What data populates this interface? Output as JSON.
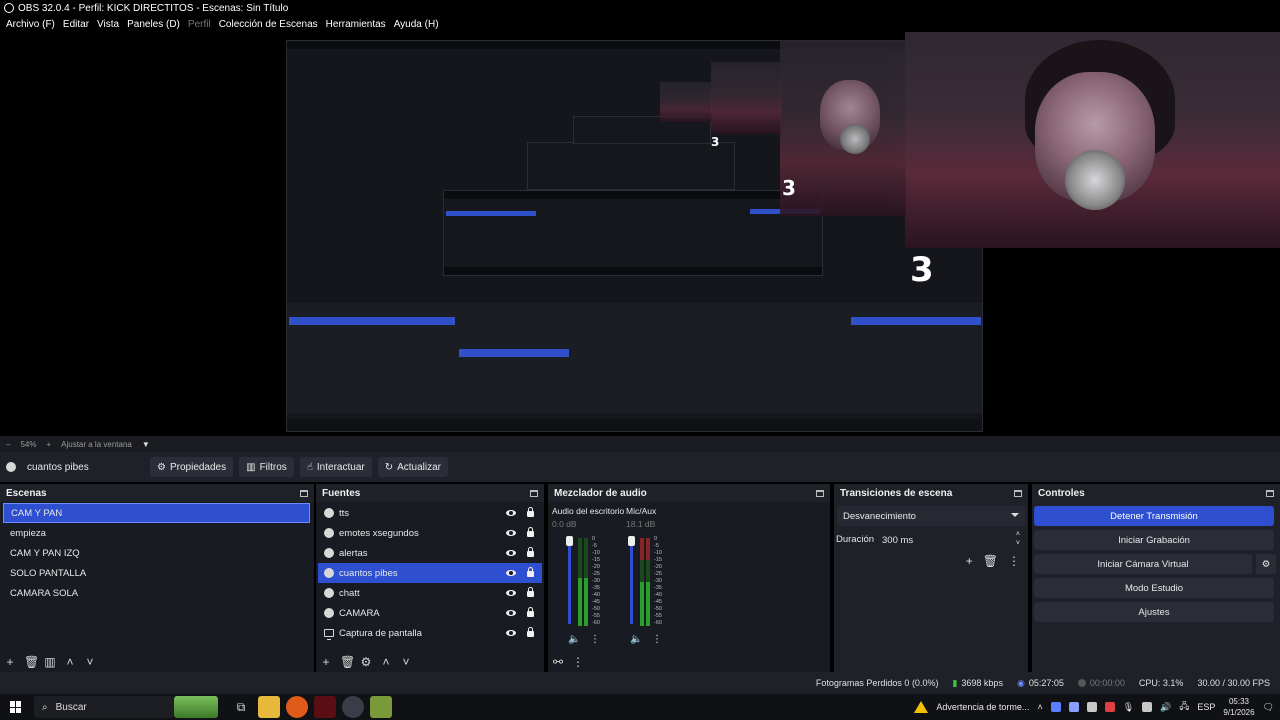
{
  "window": {
    "title": "OBS 32.0.4 - Perfil: KICK DIRECTITOS - Escenas: Sin Título"
  },
  "menu": [
    "Archivo (F)",
    "Editar",
    "Vista",
    "Paneles (D)",
    "Perfil",
    "Colección de Escenas",
    "Herramientas",
    "Ayuda (H)"
  ],
  "preview": {
    "countdown_1": "3",
    "countdown_2": "3",
    "countdown_3": "3",
    "zoom_label": "54%",
    "fit_label": "Ajustar a la ventana"
  },
  "source_toolbar": {
    "selected_source": "cuantos pibes",
    "properties": "Propiedades",
    "filters": "Filtros",
    "interact": "Interactuar",
    "refresh": "Actualizar"
  },
  "scenes": {
    "title": "Escenas",
    "items": [
      "CAM Y PAN",
      "empieza",
      "CAM Y PAN IZQ",
      "SOLO PANTALLA",
      "CAMARA SOLA"
    ],
    "selected_index": 0
  },
  "sources": {
    "title": "Fuentes",
    "items": [
      {
        "name": "tts",
        "icon": "browser-icon"
      },
      {
        "name": "emotes xsegundos",
        "icon": "browser-icon"
      },
      {
        "name": "alertas",
        "icon": "browser-icon"
      },
      {
        "name": "cuantos pibes",
        "icon": "browser-icon"
      },
      {
        "name": "chatt",
        "icon": "browser-icon"
      },
      {
        "name": "CAMARA",
        "icon": "browser-icon"
      },
      {
        "name": "Captura de pantalla",
        "icon": "monitor-icon"
      }
    ],
    "selected_index": 3
  },
  "mixer": {
    "title": "Mezclador de audio",
    "channels": [
      {
        "name": "Audio del escritorio",
        "db": "0.0 dB",
        "level": 0.55
      },
      {
        "name": "Mic/Aux",
        "db": "18.1 dB",
        "level": 0.5
      }
    ],
    "scale": [
      "0",
      "-5",
      "-10",
      "-15",
      "-20",
      "-25",
      "-30",
      "-35",
      "-40",
      "-45",
      "-50",
      "-55",
      "-60"
    ]
  },
  "transitions": {
    "title": "Transiciones de escena",
    "selected": "Desvanecimiento",
    "duration_label": "Duración",
    "duration_value": "300 ms"
  },
  "controls": {
    "title": "Controles",
    "stop_stream": "Detener Transmisión",
    "start_recording": "Iniciar Grabación",
    "start_virtual_cam": "Iniciar Cámara Virtual",
    "studio_mode": "Modo Estudio",
    "settings": "Ajustes"
  },
  "status": {
    "dropped": "Fotogramas Perdidos 0 (0.0%)",
    "bitrate": "3698 kbps",
    "stream_time": "05:27:05",
    "rec_time": "00:00:00",
    "cpu": "CPU: 3.1%",
    "fps": "30.00 / 30.00 FPS"
  },
  "taskbar": {
    "search": "Buscar",
    "warning": "Advertencia de torme...",
    "lang": "ESP",
    "time": "05:33",
    "date": "9/1/2026"
  },
  "colors": {
    "accent": "#2d4fd0",
    "dock_bg": "#1f2129",
    "meter_green": "#29a02b"
  }
}
